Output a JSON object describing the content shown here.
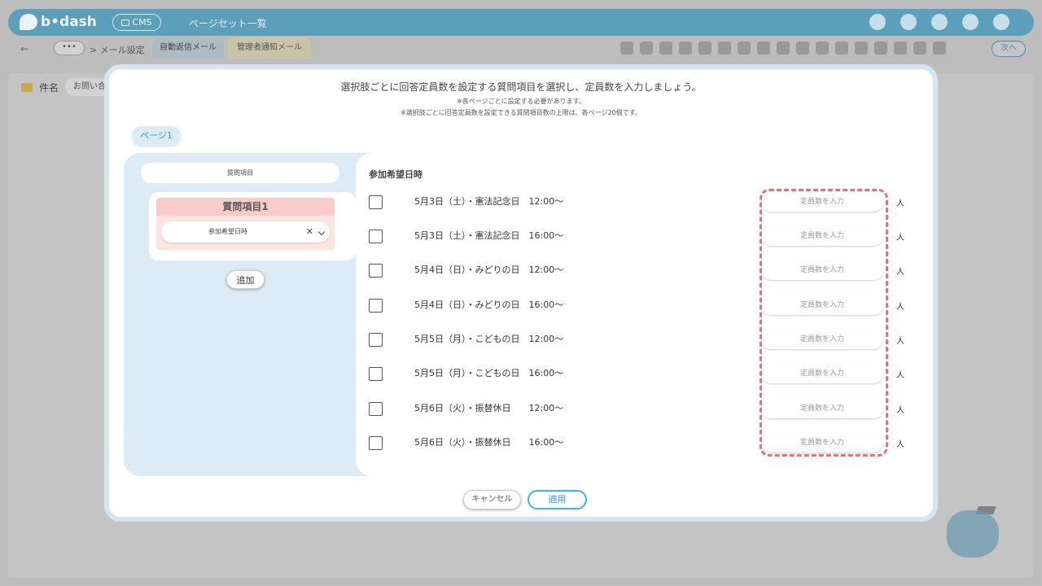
{
  "header": {
    "brand": "b•dash",
    "cms_label": "CMS",
    "title": "ページセット一覧"
  },
  "toolbar": {
    "back": "←",
    "dots": "•••",
    "breadcrumb": "> メール設定",
    "tab_active": "自動返信メール",
    "tab_other": "管理者通知メール",
    "next": "次へ"
  },
  "background": {
    "subject_label": "件名",
    "subject_value": "お問い合"
  },
  "modal": {
    "instruction": "選択肢ごとに回答定員数を設定する質問項目を選択し、定員数を入力しましょう。",
    "note1": "※各ページごとに設定する必要があります。",
    "note2": "※選択肢ごとに回答定員数を設定できる質問項目数の上限は、各ページ20個です。",
    "page_tab": "ページ1",
    "question_header": "質問項目",
    "question_title": "質問項目1",
    "question_select": "参加希望日時",
    "add_button": "追加",
    "options_title": "参加希望日時",
    "options": [
      {
        "label": "5月3日（土）・憲法記念日　12:00〜",
        "placeholder": "定員数を入力",
        "unit": "人"
      },
      {
        "label": "5月3日（土）・憲法記念日　16:00〜",
        "placeholder": "定員数を入力",
        "unit": "人"
      },
      {
        "label": "5月4日（日）・みどりの日　12:00〜",
        "placeholder": "定員数を入力",
        "unit": "人"
      },
      {
        "label": "5月4日（日）・みどりの日　16:00〜",
        "placeholder": "定員数を入力",
        "unit": "人"
      },
      {
        "label": "5月5日（月）・こどもの日　12:00〜",
        "placeholder": "定員数を入力",
        "unit": "人"
      },
      {
        "label": "5月5日（月）・こどもの日　16:00〜",
        "placeholder": "定員数を入力",
        "unit": "人"
      },
      {
        "label": "5月6日（火）・振替休日　　12:00〜",
        "placeholder": "定員数を入力",
        "unit": "人"
      },
      {
        "label": "5月6日（火）・振替休日　　16:00〜",
        "placeholder": "定員数を入力",
        "unit": "人"
      }
    ],
    "cancel": "キャンセル",
    "apply": "適用"
  },
  "colors": {
    "accent": "#2e9fe0",
    "highlight_dash": "#e8707a",
    "question_pink": "#f9ccc7",
    "panel_blue": "#ddebf6"
  }
}
